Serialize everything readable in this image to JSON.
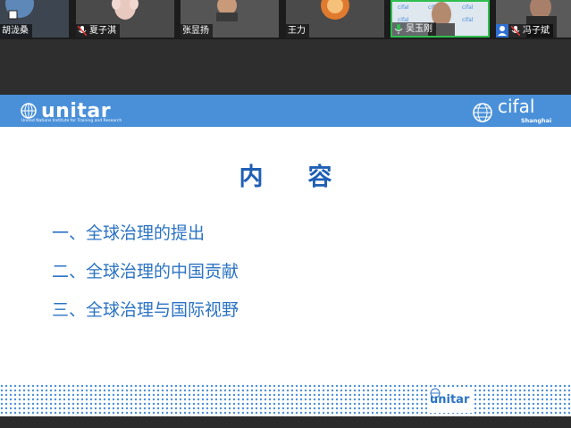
{
  "participants": [
    {
      "name": "胡泷桑",
      "muted": false,
      "active": false
    },
    {
      "name": "夏子淇",
      "muted": true,
      "active": false
    },
    {
      "name": "张昱扬",
      "muted": false,
      "active": false
    },
    {
      "name": "王力",
      "muted": false,
      "active": false
    },
    {
      "name": "吴玉刚",
      "muted": false,
      "active": true
    },
    {
      "name": "冯子斌",
      "muted": true,
      "active": false
    }
  ],
  "slide": {
    "header": {
      "left_logo_text": "unitar",
      "left_logo_subtitle": "United Nations Institute for Training and Research",
      "right_logo_text": "cifal",
      "right_logo_subtitle": "Shanghai"
    },
    "title": "内容",
    "items": [
      "一、全球治理的提出",
      "二、全球治理的中国贡献",
      "三、全球治理与国际视野"
    ],
    "footer_logo_text": "unitar"
  },
  "colors": {
    "header_blue": "#4a90d9",
    "title_blue": "#1f5fb4",
    "item_blue": "#2b73c4",
    "active_speaker": "#2fbf4f"
  }
}
